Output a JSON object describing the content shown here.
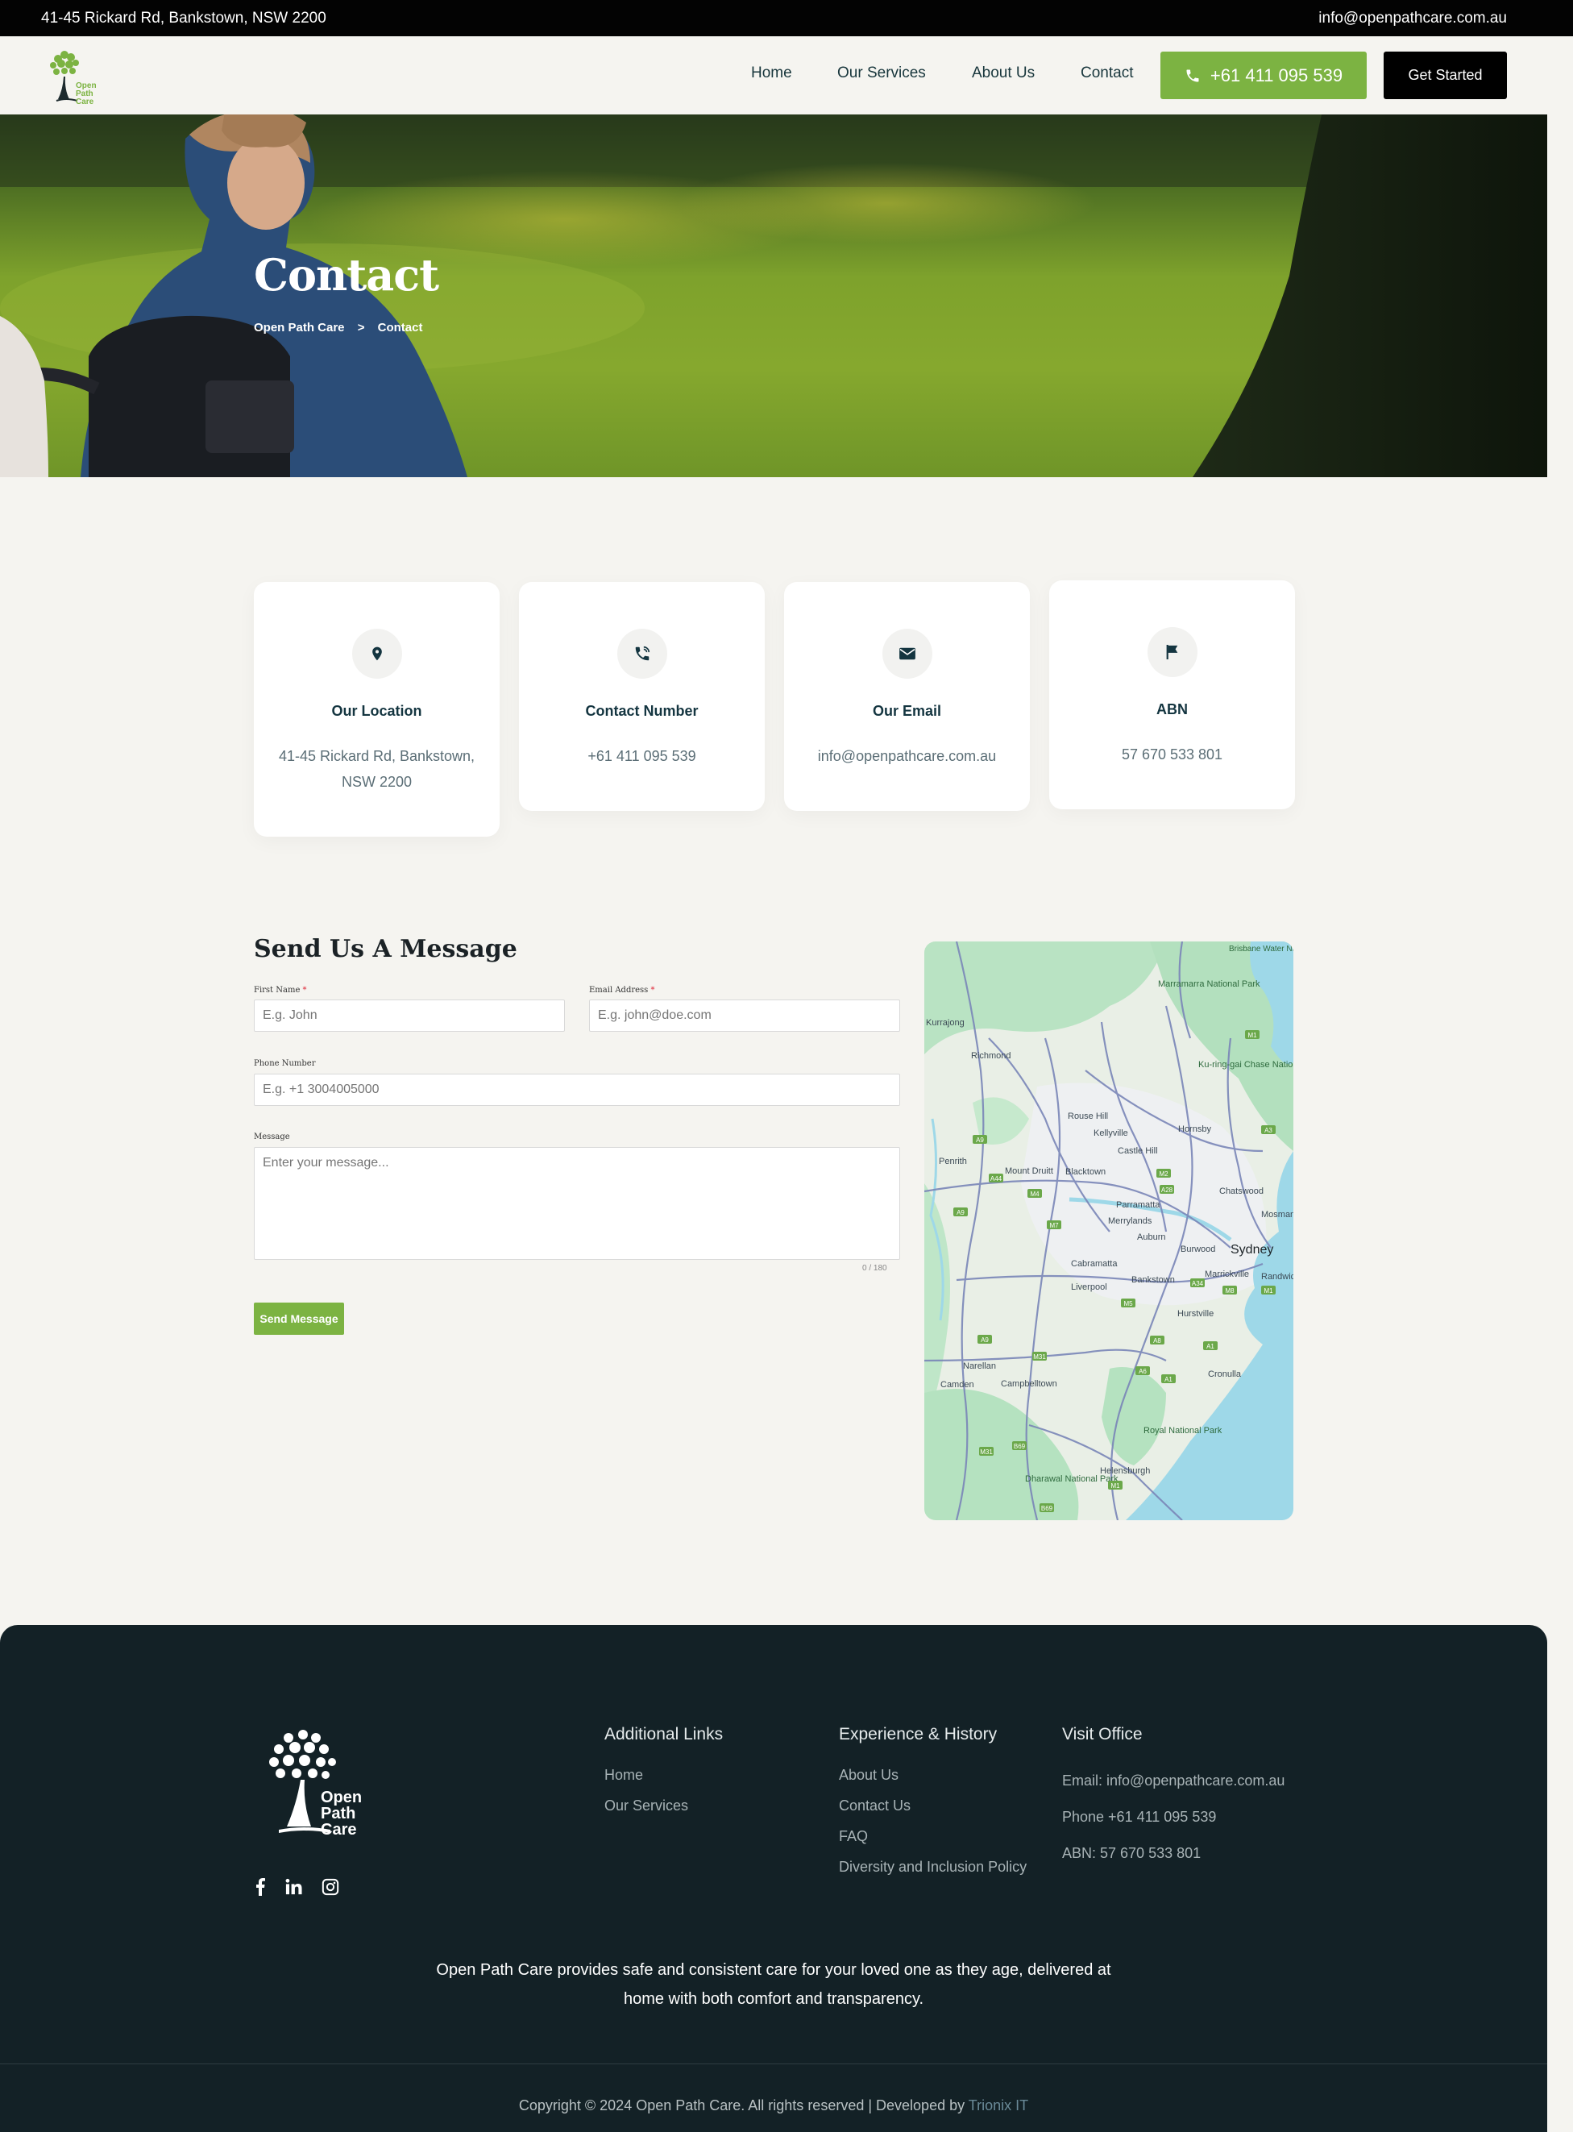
{
  "topbar": {
    "address": "41-45 Rickard Rd, Bankstown, NSW 2200",
    "email": "info@openpathcare.com.au"
  },
  "header": {
    "logo_text": [
      "Open",
      "Path",
      "Care"
    ],
    "nav": [
      "Home",
      "Our Services",
      "About Us",
      "Contact"
    ],
    "phone": "+61 411 095 539",
    "cta": "Get Started"
  },
  "hero": {
    "title": "Contact",
    "breadcrumb": [
      "Open Path Care",
      ">",
      "Contact"
    ]
  },
  "cards": [
    {
      "icon": "location-pin-icon",
      "title": "Our Location",
      "value": "41-45 Rickard Rd, Bankstown, NSW 2200"
    },
    {
      "icon": "phone-icon",
      "title": "Contact Number",
      "value": "+61 411 095 539"
    },
    {
      "icon": "envelope-icon",
      "title": "Our Email",
      "value": "info@openpathcare.com.au"
    },
    {
      "icon": "flag-icon",
      "title": "ABN",
      "value": "57 670 533 801"
    }
  ],
  "form": {
    "title": "Send Us A Message",
    "first_name_label": "First Name",
    "first_name_placeholder": "E.g. John",
    "email_label": "Email Address",
    "email_placeholder": "E.g. john@doe.com",
    "required_mark": "*",
    "phone_label": "Phone Number",
    "phone_placeholder": "E.g. +1 3004005000",
    "message_label": "Message",
    "message_placeholder": "Enter your message...",
    "counter": "0 / 180",
    "submit": "Send Message"
  },
  "map": {
    "labels": [
      "Marramarra National Park",
      "Kurrajong",
      "Richmond",
      "Ku-ring-gai Chase National Park",
      "Rouse Hill",
      "Kellyville",
      "Hornsby",
      "Castle Hill",
      "Penrith",
      "Mount Druitt",
      "Blacktown",
      "Chatswood",
      "Parramatta",
      "Merrylands",
      "Auburn",
      "Burwood",
      "Sydney",
      "Mosman",
      "Cabramatta",
      "Bankstown",
      "Marrickville",
      "Randwick",
      "Liverpool",
      "Hurstville",
      "Narellan",
      "Camden",
      "Campbelltown",
      "Cronulla",
      "Royal National Park",
      "Dharawal National Park",
      "Helensburgh",
      "Brisbane Water National"
    ],
    "shields": [
      "M1",
      "A3",
      "A9",
      "A44",
      "M4",
      "M2",
      "A28",
      "A9",
      "M7",
      "A34",
      "M8",
      "M1",
      "M5",
      "A8",
      "A1",
      "A6",
      "A1",
      "M31",
      "A9",
      "B69",
      "M31",
      "M1",
      "B69"
    ],
    "colors": {
      "land": "#e9efe6",
      "park": "#b9e3c3",
      "water": "#9ed8e8",
      "road": "#7a86b8"
    }
  },
  "footer": {
    "logo_text": [
      "Open",
      "Path",
      "Care"
    ],
    "social": [
      "facebook-icon",
      "linkedin-icon",
      "instagram-icon"
    ],
    "col1": {
      "title": "Additional Links",
      "links": [
        "Home",
        "Our Services"
      ]
    },
    "col2": {
      "title": "Experience & History",
      "links": [
        "About Us",
        "Contact Us",
        "FAQ",
        "Diversity and Inclusion Policy"
      ]
    },
    "col3": {
      "title": "Visit Office",
      "items": [
        "Email: info@openpathcare.com.au",
        "Phone +61 411 095 539",
        "ABN: 57 670 533 801"
      ]
    },
    "about_line1": "Open Path Care provides safe and consistent care for your loved one as they age, delivered at",
    "about_line2": "home with both comfort and transparency.",
    "copyright": "Copyright © 2024 Open Path Care. All rights reserved | Developed by ",
    "developer": "Trionix IT"
  },
  "colors": {
    "accent": "#7cb342",
    "dark": "#132126",
    "topbar": "#030303"
  }
}
